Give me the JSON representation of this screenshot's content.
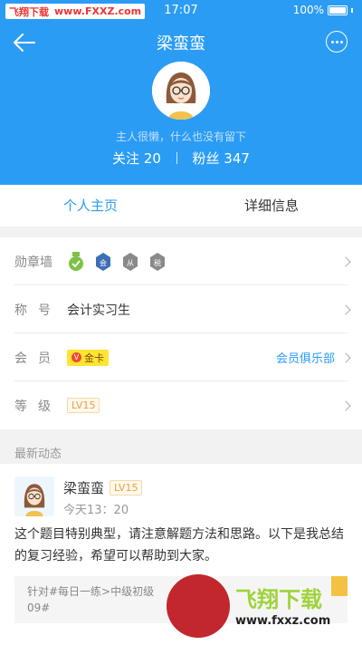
{
  "statusbar": {
    "brand": "飞翔下载",
    "url": "www.FXXZ.com",
    "time": "17:07",
    "battery": "100%"
  },
  "header": {
    "title": "梁蛮蛮",
    "bio": "主人很懒，什么也没有留下",
    "following_label": "关注",
    "following_count": "20",
    "fans_label": "粉丝",
    "fans_count": "347",
    "bg_color": "#2b9cf4"
  },
  "tabs": [
    {
      "label": "个人主页",
      "active": true
    },
    {
      "label": "详细信息",
      "active": false
    }
  ],
  "info": {
    "medals_label": "勋章墙",
    "medals": [
      {
        "icon": "green-check-medal-icon",
        "color": "#7dc243"
      },
      {
        "icon": "blue-hui-medal-icon",
        "color": "#3d6fb6",
        "char": "会"
      },
      {
        "icon": "gray-cong-medal-icon",
        "color": "#8a8a8a",
        "char": "从"
      },
      {
        "icon": "gray-shui-medal-icon",
        "color": "#8a8a8a",
        "char": "税"
      }
    ],
    "title_label": "称号",
    "title_value": "会计实习生",
    "member_label": "会员",
    "member_badge": "金卡",
    "member_badge_mark": "V",
    "member_link": "会员俱乐部",
    "level_label": "等级",
    "level_value": "LV15"
  },
  "feed_section_title": "最新动态",
  "feed": {
    "name": "梁蛮蛮",
    "level": "LV15",
    "time": "今天13：20",
    "text": "这个题目特别典型，请注意解题方法和思路。以下是我总结的复习经验，希望可以帮助到大家。",
    "quote_line1": "针对#每日一练>中级初级",
    "quote_line2": "09#"
  },
  "watermark": {
    "text": "飞翔下载",
    "url": "www.fxxz.com"
  }
}
